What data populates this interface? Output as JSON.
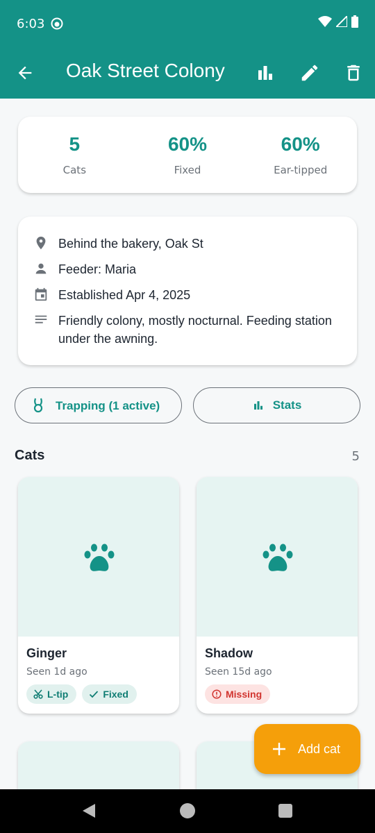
{
  "status": {
    "time": "6:03"
  },
  "appbar": {
    "title": "Oak Street Colony"
  },
  "stats": [
    {
      "value": "5",
      "label": "Cats"
    },
    {
      "value": "60%",
      "label": "Fixed"
    },
    {
      "value": "60%",
      "label": "Ear-tipped"
    }
  ],
  "info": {
    "location": "Behind the bakery, Oak St",
    "feeder": "Feeder: Maria",
    "established": "Established Apr 4, 2025",
    "notes": "Friendly colony, mostly nocturnal. Feeding station under the awning."
  },
  "actions": {
    "trapping": "Trapping (1 active)",
    "stats": "Stats"
  },
  "cats_section": {
    "title": "Cats",
    "count": "5"
  },
  "cats": [
    {
      "name": "Ginger",
      "seen": "Seen 1d ago",
      "tags": [
        "L-tip",
        "Fixed"
      ]
    },
    {
      "name": "Shadow",
      "seen": "Seen 15d ago",
      "tags": [
        "Missing"
      ]
    }
  ],
  "fab": {
    "label": "Add cat"
  },
  "colors": {
    "primary": "#149287",
    "accent": "#f59f0a",
    "danger": "#d1342f"
  }
}
